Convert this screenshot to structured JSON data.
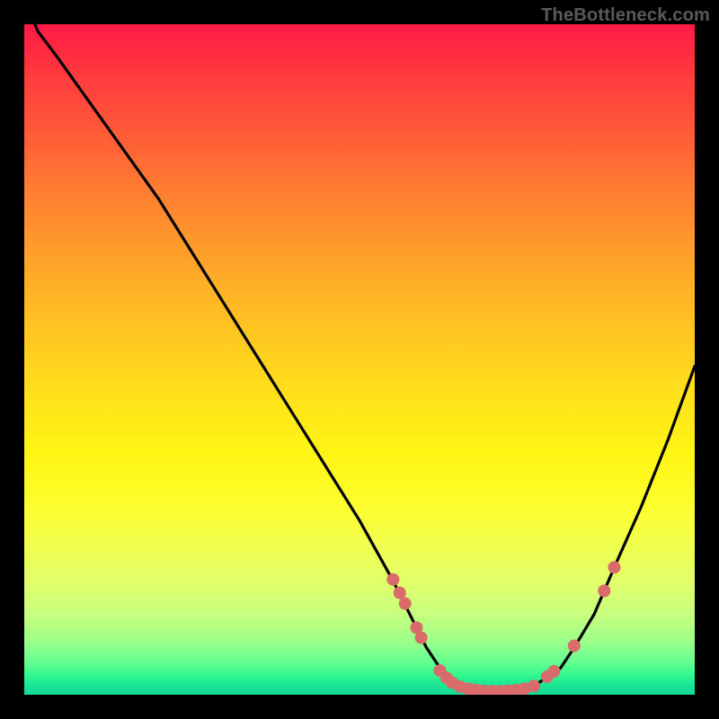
{
  "watermark": {
    "text": "TheBottleneck.com"
  },
  "chart_data": {
    "type": "line",
    "title": "",
    "xlabel": "",
    "ylabel": "",
    "xlim": [
      0,
      100
    ],
    "ylim": [
      0,
      100
    ],
    "series": [
      {
        "name": "curve",
        "x": [
          0,
          2,
          5,
          10,
          15,
          20,
          25,
          30,
          35,
          40,
          45,
          50,
          55,
          58,
          60,
          62,
          65,
          68,
          72,
          76,
          80,
          82,
          85,
          88,
          92,
          96,
          100
        ],
        "values": [
          104,
          99,
          95,
          88,
          81,
          74,
          66,
          58,
          50,
          42,
          34,
          26,
          17,
          11,
          7,
          4,
          1.5,
          0.5,
          0.5,
          1.3,
          4,
          7,
          12,
          19,
          28,
          38,
          49
        ]
      }
    ],
    "marker_points": {
      "name": "dots",
      "color": "#d96b6b",
      "radius": 7,
      "points": [
        [
          55.0,
          17.2
        ],
        [
          56.0,
          15.2
        ],
        [
          56.8,
          13.6
        ],
        [
          58.5,
          10.0
        ],
        [
          59.2,
          8.5
        ],
        [
          62.0,
          3.6
        ],
        [
          63.0,
          2.5
        ],
        [
          63.8,
          1.8
        ],
        [
          65.0,
          1.2
        ],
        [
          66.2,
          0.9
        ],
        [
          67.3,
          0.7
        ],
        [
          68.5,
          0.6
        ],
        [
          69.8,
          0.55
        ],
        [
          71.0,
          0.55
        ],
        [
          72.2,
          0.6
        ],
        [
          73.4,
          0.7
        ],
        [
          74.6,
          0.9
        ],
        [
          76.0,
          1.3
        ],
        [
          78.0,
          2.7
        ],
        [
          79.0,
          3.5
        ],
        [
          82.0,
          7.3
        ],
        [
          86.5,
          15.5
        ],
        [
          88.0,
          19.0
        ]
      ]
    }
  }
}
